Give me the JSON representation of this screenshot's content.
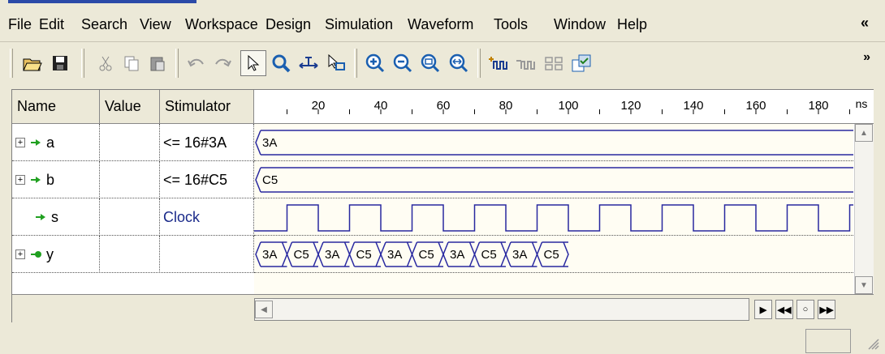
{
  "menu": {
    "items": [
      "File",
      "Edit",
      "Search",
      "View",
      "Workspace",
      "Design",
      "Simulation",
      "Waveform",
      "Tools",
      "Window",
      "Help"
    ],
    "collapse": "«"
  },
  "toolbar": {
    "buttons": [
      "open-icon",
      "save-icon",
      "cut-icon",
      "copy-icon",
      "paste-icon",
      "undo-icon",
      "redo-icon",
      "select-icon",
      "zoom-icon",
      "measure-icon",
      "cursor-icon",
      "zoom-in-icon",
      "zoom-out-icon",
      "zoom-fit-icon",
      "zoom-full-icon",
      "add-signal-icon",
      "remove-signal-icon",
      "stimulator-icon",
      "compare-icon"
    ],
    "more": "»"
  },
  "columns": {
    "name": "Name",
    "value": "Value",
    "stimulator": "Stimulator"
  },
  "ruler": {
    "ticks": [
      "20",
      "40",
      "60",
      "80",
      "100",
      "120",
      "140",
      "160",
      "180"
    ],
    "unit": "ns"
  },
  "signals": [
    {
      "name": "a",
      "stimulator": "<= 16#3A",
      "expandable": true,
      "wave": "3A"
    },
    {
      "name": "b",
      "stimulator": "<= 16#C5",
      "expandable": true,
      "wave": "C5"
    },
    {
      "name": "s",
      "stimulator": "Clock",
      "expandable": false
    },
    {
      "name": "y",
      "stimulator": "",
      "expandable": true,
      "bus": [
        "3A",
        "C5",
        "3A",
        "C5",
        "3A",
        "C5",
        "3A",
        "C5",
        "3A",
        "C5"
      ]
    }
  ],
  "colors": {
    "waveform": "#2828a0",
    "signal_icon": "#20a020"
  }
}
